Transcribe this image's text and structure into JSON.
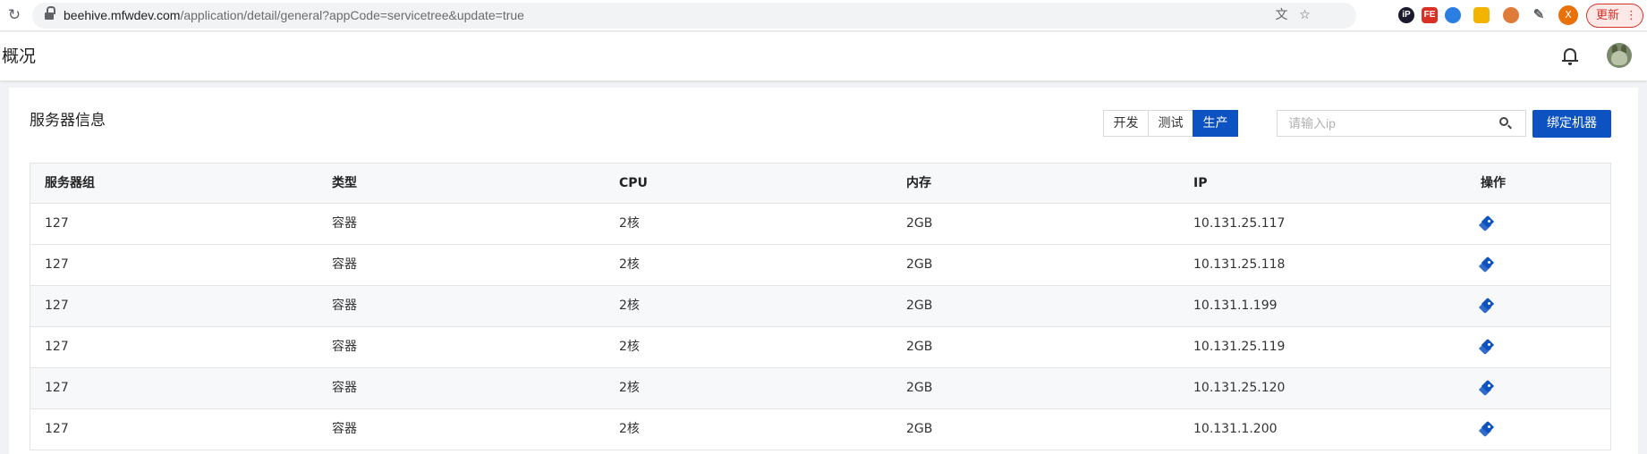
{
  "browser": {
    "url_host": "beehive.mfwdev.com",
    "url_path": "/application/detail/general?appCode=servicetree&update=true",
    "profile_initial": "X",
    "update_label": "更新"
  },
  "header": {
    "title": "概况"
  },
  "section": {
    "title": "服务器信息",
    "env_tabs": [
      {
        "label": "开发",
        "active": false
      },
      {
        "label": "测试",
        "active": false
      },
      {
        "label": "生产",
        "active": true
      }
    ],
    "search_placeholder": "请输入ip",
    "bind_button_label": "绑定机器"
  },
  "table": {
    "columns": [
      "服务器组",
      "类型",
      "CPU",
      "内存",
      "IP",
      "操作"
    ],
    "rows": [
      {
        "group": "127",
        "type": "容器",
        "cpu": "2核",
        "memory": "2GB",
        "ip": "10.131.25.117"
      },
      {
        "group": "127",
        "type": "容器",
        "cpu": "2核",
        "memory": "2GB",
        "ip": "10.131.25.118"
      },
      {
        "group": "127",
        "type": "容器",
        "cpu": "2核",
        "memory": "2GB",
        "ip": "10.131.1.199"
      },
      {
        "group": "127",
        "type": "容器",
        "cpu": "2核",
        "memory": "2GB",
        "ip": "10.131.25.119"
      },
      {
        "group": "127",
        "type": "容器",
        "cpu": "2核",
        "memory": "2GB",
        "ip": "10.131.25.120"
      },
      {
        "group": "127",
        "type": "容器",
        "cpu": "2核",
        "memory": "2GB",
        "ip": "10.131.1.200"
      }
    ]
  },
  "colors": {
    "primary": "#0d52c1",
    "update_red": "#d93025"
  }
}
